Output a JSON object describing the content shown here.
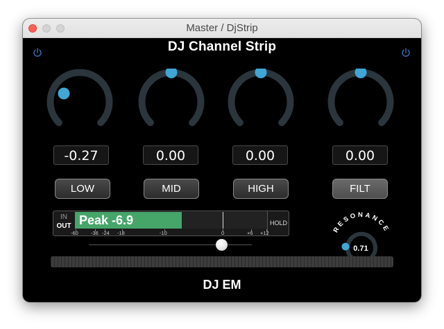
{
  "window": {
    "title": "Master / DjStrip"
  },
  "plugin": {
    "title": "DJ Channel Strip",
    "footer": "DJ EM"
  },
  "knobs": [
    {
      "name": "low",
      "value_text": "-0.27",
      "label": "LOW",
      "value": -0.27
    },
    {
      "name": "mid",
      "value_text": "0.00",
      "label": "MID",
      "value": 0.0
    },
    {
      "name": "high",
      "value_text": "0.00",
      "label": "HIGH",
      "value": 0.0
    },
    {
      "name": "filt",
      "value_text": "0.00",
      "label": "FILT",
      "value": 0.0
    }
  ],
  "meter": {
    "in_label": "IN",
    "out_label": "OUT",
    "peak_text": "Peak -6.9",
    "hold_label": "HOLD",
    "scale": [
      "-60",
      "-36",
      "-24",
      "-18",
      "-10",
      "0",
      "+6",
      "+12"
    ]
  },
  "resonance": {
    "label": "RESONANCE",
    "value_text": "0.71",
    "value": 0.71
  },
  "colors": {
    "accent": "#3fa6d5",
    "meter_fill": "#46a66a",
    "background": "#000000"
  }
}
